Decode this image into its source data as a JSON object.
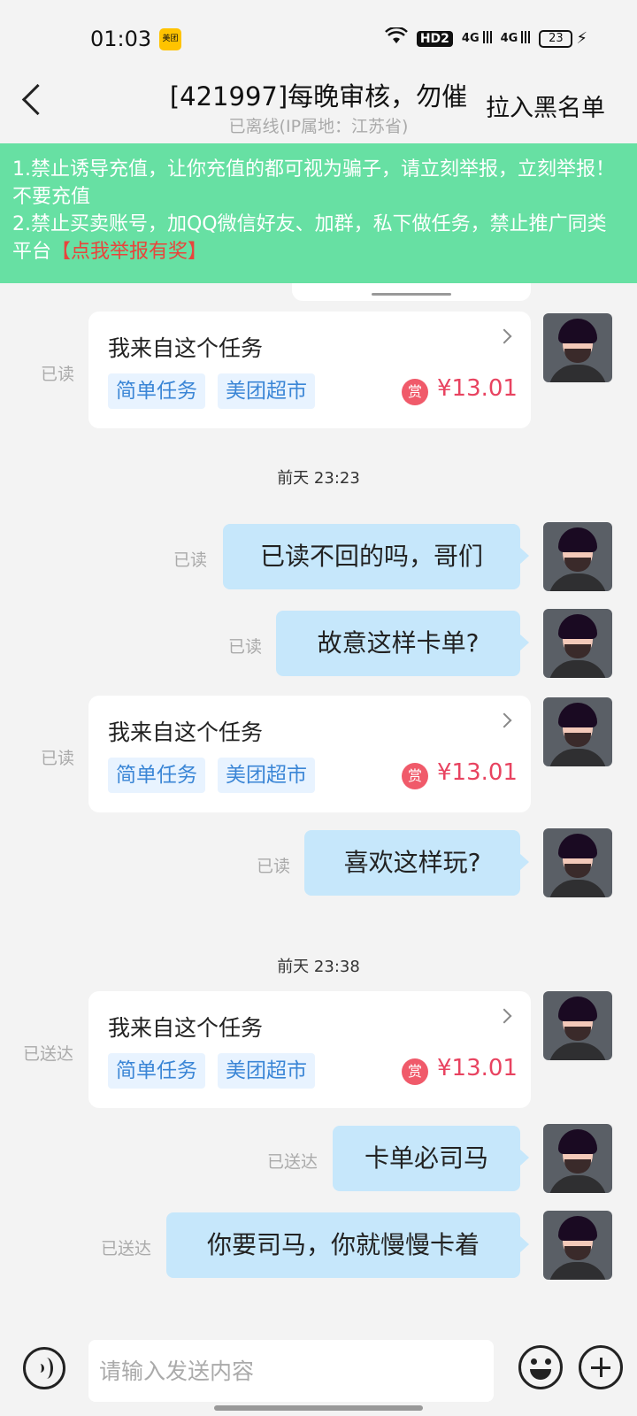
{
  "status_bar": {
    "time": "01:03",
    "app_badge": "美团",
    "hd_label": "HD2",
    "signal1": "4G",
    "signal2": "4G",
    "battery": "23"
  },
  "header": {
    "title": "[421997]每晚审核，勿催",
    "subtitle": "已离线(IP属地：江苏省)",
    "blacklist_label": "拉入黑名单"
  },
  "notice": {
    "line1": "1.禁止诱导充值，让你充值的都可视为骗子，请立刻举报，立刻举报！不要充值",
    "line2": "2.禁止买卖账号，加QQ微信好友、加群，私下做任务，禁止推广同类平台",
    "report_link": "【点我举报有奖】"
  },
  "task": {
    "title": "我来自这个任务",
    "tag1": "简单任务",
    "tag2": "美团超市",
    "reward_icon": "赏",
    "price": "¥13.01"
  },
  "messages": {
    "m1_status": "已读",
    "ts1": "前天 23:23",
    "m2_text": "已读不回的吗，哥们",
    "m2_status": "已读",
    "m3_text": "故意这样卡单?",
    "m3_status": "已读",
    "m4_status": "已读",
    "m5_text": "喜欢这样玩?",
    "m5_status": "已读",
    "ts2": "前天 23:38",
    "m6_status": "已送达",
    "m7_text": "卡单必司马",
    "m7_status": "已送达",
    "m8_text": "你要司马，你就慢慢卡着",
    "m8_status": "已送达"
  },
  "input": {
    "placeholder": "请输入发送内容"
  },
  "colors": {
    "notice_bg": "#67e0a3",
    "bubble_bg": "#c6e7fb",
    "price": "#e84360",
    "tag_text": "#3b86d6"
  }
}
